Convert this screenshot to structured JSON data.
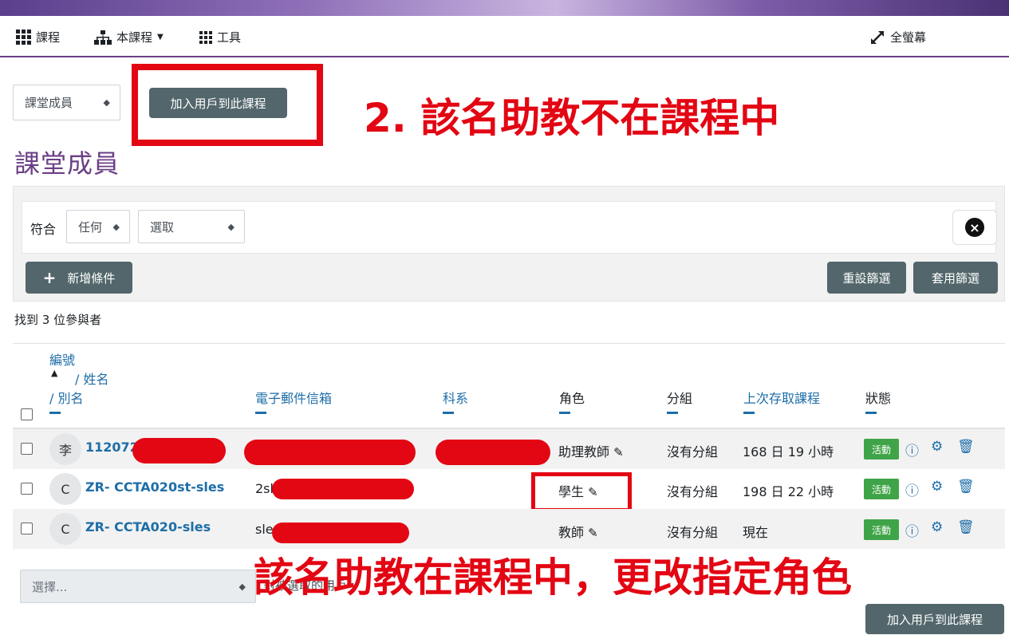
{
  "nav": {
    "courses": "課程",
    "this_course": "本課程",
    "tools": "工具",
    "fullscreen": "全螢幕"
  },
  "toolbar": {
    "page_select": "課堂成員",
    "enrol_button": "加入用戶到此課程"
  },
  "annotations": {
    "top": "2.  該名助教不在課程中",
    "bottom": "該名助教在課程中，更改指定角色",
    "color": "#e30613"
  },
  "page_title": "課堂成員",
  "filter": {
    "match_label": "符合",
    "match_value": "任何",
    "select_value": "選取",
    "add_condition": "新增條件",
    "reset": "重設篩選",
    "apply": "套用篩選"
  },
  "found_text": "找到 3 位參與者",
  "table": {
    "headers": {
      "id_number": "編號",
      "sort_arrow": "▲",
      "name": "/ 姓名",
      "alt_name": "/ 別名",
      "email": "電子郵件信箱",
      "department": "科系",
      "roles": "角色",
      "groups": "分組",
      "last_access": "上次存取課程",
      "status": "狀態"
    },
    "rows": [
      {
        "avatar": "李",
        "name": "112072",
        "email": "",
        "department": "",
        "role": "助理教師",
        "group": "沒有分組",
        "last_access": "168 日 19 小時",
        "status": "活動"
      },
      {
        "avatar": "C",
        "name": "ZR- CCTA020st-sles",
        "email": "2sl",
        "department": "",
        "role": "學生",
        "group": "沒有分組",
        "last_access": "198 日 22 小時",
        "status": "活動"
      },
      {
        "avatar": "C",
        "name": "ZR- CCTA020-sles",
        "email": "sle",
        "department": "",
        "role": "教師",
        "group": "沒有分組",
        "last_access": "現在",
        "status": "活動"
      }
    ]
  },
  "bulk": {
    "placeholder": "選擇...",
    "hint": "對被選取的用戶"
  },
  "footer_enrol": "加入用戶到此課程",
  "colors": {
    "accent": "#6b3f86",
    "button": "#52666b",
    "link": "#1e6ea8",
    "status_active": "#3fa447"
  }
}
